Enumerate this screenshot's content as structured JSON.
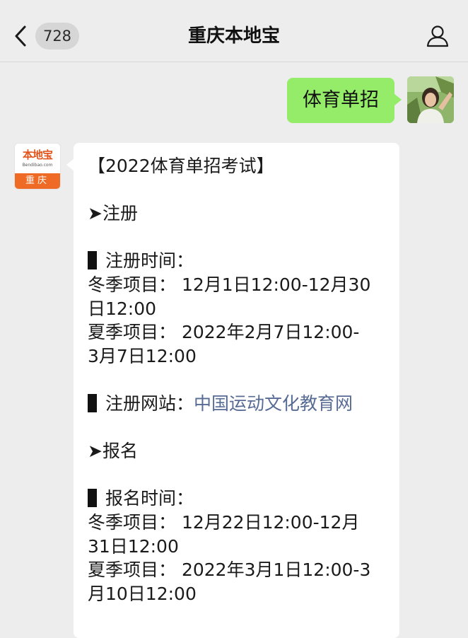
{
  "header": {
    "back_count": "728",
    "title": "重庆本地宝"
  },
  "outgoing": {
    "text": "体育单招"
  },
  "incoming": {
    "logo_top": "本地宝",
    "logo_sub": "Bendibao.com",
    "logo_bottom": "重庆",
    "title": "【2022体育单招考试】",
    "section_register": "➤注册",
    "register_time_label": "注册时间：",
    "register_winter_1": "冬季项目： 12月1日12:00-12月30",
    "register_winter_2": "日12:00",
    "register_summer_1": "夏季项目： 2022年2月7日12:00-",
    "register_summer_2": "3月7日12:00",
    "register_site_label": "注册网站：",
    "register_site_link": "中国运动文化教育网",
    "section_apply": "➤报名",
    "apply_time_label": "报名时间：",
    "apply_winter_1": "冬季项目： 12月22日12:00-12月",
    "apply_winter_2": "31日12:00",
    "apply_summer_1": "夏季项目： 2022年3月1日12:00-3",
    "apply_summer_2": "月10日12:00"
  },
  "colors": {
    "background": "#ededed",
    "outgoing_bubble": "#95ec69",
    "link": "#576b95",
    "logo_orange": "#ee6a25"
  },
  "icons": {
    "back": "chevron-left-icon",
    "profile": "person-icon"
  }
}
